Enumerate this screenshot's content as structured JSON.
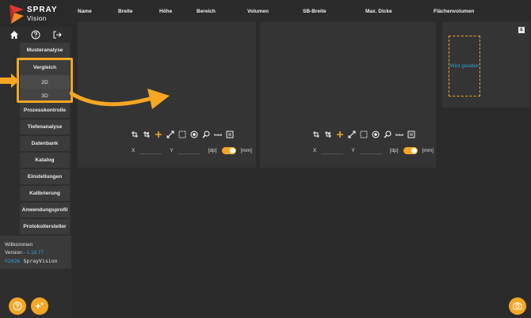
{
  "brand": {
    "name": "SPRAY",
    "sub": "Vision"
  },
  "header": {
    "columns": [
      "Name",
      "Breite",
      "Höhe",
      "Bereich",
      "Volumen",
      "SB-Breite",
      "Max. Dicke",
      "Flächenvolumen"
    ]
  },
  "sidebar": {
    "items": [
      {
        "label": "Musteranalyse"
      },
      {
        "label": "Vergleich"
      },
      {
        "label": "2D"
      },
      {
        "label": "3D"
      },
      {
        "label": "Prozesskontrolle"
      },
      {
        "label": "Tiefenanalyse"
      },
      {
        "label": "Datenbank"
      },
      {
        "label": "Katalog"
      },
      {
        "label": "Einstellungen"
      },
      {
        "label": "Kalibrierung"
      },
      {
        "label": "Anwendungsprofil"
      },
      {
        "label": "Protokollersteller"
      }
    ]
  },
  "welcome": {
    "greeting": "Willkommen",
    "version_label": "Version - ",
    "version": "1.18.77",
    "copyright_year": "©2026",
    "copyright_name": " SprayVision"
  },
  "panels": {
    "left": {
      "x_label": "X",
      "y_label": "Y",
      "dp_label": "[dp]",
      "mm_label": "[mm]"
    },
    "right": {
      "x_label": "X",
      "y_label": "Y",
      "dp_label": "[dp]",
      "mm_label": "[mm]"
    }
  },
  "preview": {
    "badge": "E",
    "loading_text": "Wird geladen"
  },
  "colors": {
    "accent": "#f5a623",
    "link": "#2fa0d6",
    "background": "#2b2b2b",
    "panel": "#343434"
  }
}
